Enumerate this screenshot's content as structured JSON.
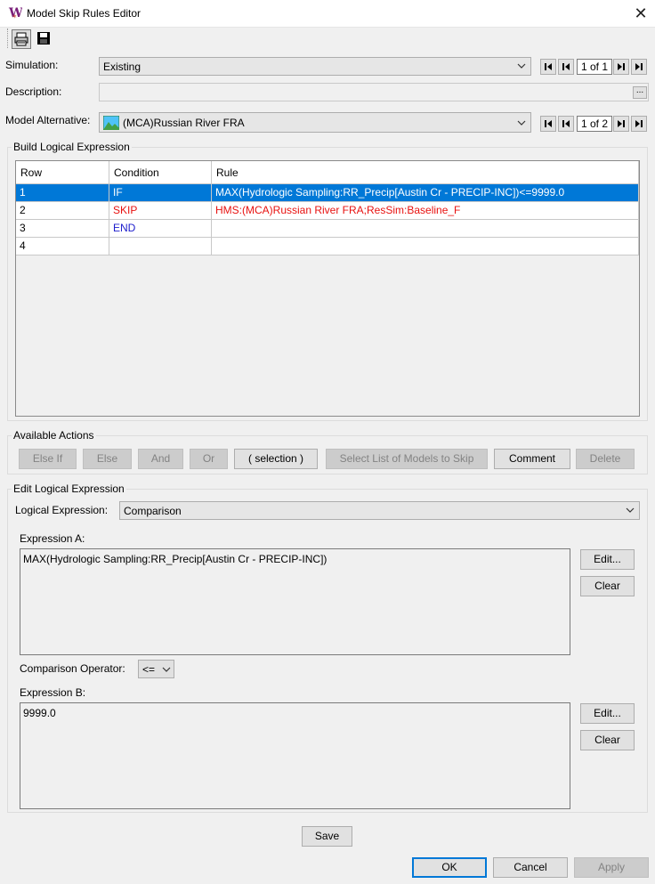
{
  "window": {
    "title": "Model Skip Rules Editor",
    "close_glyph": "✕"
  },
  "toolbar": {
    "icons": [
      "print-icon",
      "save-icon"
    ]
  },
  "simulation": {
    "label": "Simulation:",
    "value": "Existing",
    "nav": "1 of 1"
  },
  "description": {
    "label": "Description:",
    "value": "",
    "button": "..."
  },
  "model_alternative": {
    "label": "Model Alternative:",
    "value": "(MCA)Russian River FRA",
    "nav": "1 of 2"
  },
  "build": {
    "title": "Build Logical Expression",
    "columns": [
      "Row",
      "Condition",
      "Rule"
    ],
    "rows": [
      {
        "row": "1",
        "condition": "IF",
        "rule": "MAX(Hydrologic Sampling:RR_Precip[Austin Cr - PRECIP-INC])<=9999.0",
        "cond_color": "#ffffff",
        "rule_color": "#ffffff"
      },
      {
        "row": "2",
        "condition": "SKIP",
        "rule": "HMS:(MCA)Russian River FRA;ResSim:Baseline_F",
        "cond_color": "#e8110f",
        "rule_color": "#e8110f"
      },
      {
        "row": "3",
        "condition": "END",
        "rule": "",
        "cond_color": "#1c1ccc",
        "rule_color": "#000000"
      },
      {
        "row": "4",
        "condition": "",
        "rule": "",
        "cond_color": "#000000",
        "rule_color": "#000000"
      }
    ]
  },
  "actions": {
    "title": "Available Actions",
    "else_if": "Else If",
    "else": "Else",
    "and": "And",
    "or": "Or",
    "selection": "( selection )",
    "select_list": "Select List of Models to Skip",
    "comment": "Comment",
    "delete": "Delete"
  },
  "edit": {
    "title": "Edit Logical Expression",
    "logical_label": "Logical Expression:",
    "logical_value": "Comparison",
    "expr_a_label": "Expression A:",
    "expr_a_value": "MAX(Hydrologic Sampling:RR_Precip[Austin Cr - PRECIP-INC])",
    "edit_a": "Edit...",
    "clear_a": "Clear",
    "op_label": "Comparison Operator:",
    "op_value": "<=",
    "expr_b_label": "Expression B:",
    "expr_b_value": "9999.0",
    "edit_b": "Edit...",
    "clear_b": "Clear"
  },
  "footer": {
    "save": "Save",
    "ok": "OK",
    "cancel": "Cancel",
    "apply": "Apply"
  },
  "colors": {
    "selection": "#0078d7",
    "skip": "#e8110f",
    "end": "#1c1ccc"
  }
}
